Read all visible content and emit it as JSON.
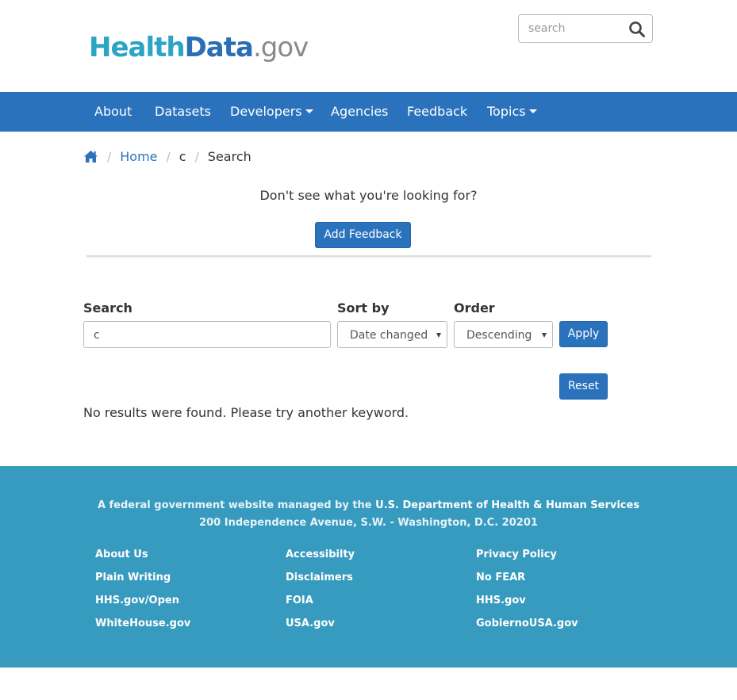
{
  "header": {
    "logo": {
      "part1": "Health",
      "part2": "Data",
      "part3": ".gov"
    },
    "search": {
      "placeholder": "search",
      "icon": "search-icon"
    }
  },
  "nav": {
    "items": [
      {
        "label": "About",
        "dropdown": false
      },
      {
        "label": "Datasets",
        "dropdown": false
      },
      {
        "label": "Developers",
        "dropdown": true
      },
      {
        "label": "Agencies",
        "dropdown": false
      },
      {
        "label": "Feedback",
        "dropdown": false
      },
      {
        "label": "Topics",
        "dropdown": true
      }
    ]
  },
  "breadcrumb": {
    "home_icon": "home-icon",
    "items": [
      "Home",
      "c",
      "Search"
    ]
  },
  "feedback": {
    "prompt": "Don't see what you're looking for?",
    "button_label": "Add Feedback"
  },
  "search_form": {
    "search_label": "Search",
    "search_value": "c",
    "sort_label": "Sort by",
    "sort_value": "Date changed",
    "order_label": "Order",
    "order_value": "Descending",
    "apply_label": "Apply",
    "reset_label": "Reset"
  },
  "results": {
    "message": "No results were found. Please try another keyword."
  },
  "footer": {
    "line1_prefix": "A federal government website managed by the ",
    "line1_link": "U.S. Department of Health & Human Services",
    "line2": "200 Independence Avenue, S.W. - Washington, D.C. 20201",
    "columns": [
      [
        "About Us",
        "Plain Writing",
        "HHS.gov/Open",
        "WhiteHouse.gov"
      ],
      [
        "Accessibilty",
        "Disclaimers",
        "FOIA",
        "USA.gov"
      ],
      [
        "Privacy Policy",
        "No FEAR",
        "HHS.gov",
        "GobiernoUSA.gov"
      ]
    ]
  },
  "colors": {
    "nav_bg": "#2b72bd",
    "footer_bg": "#379abf",
    "logo_health": "#2ba4c5",
    "logo_data": "#2a6fb4",
    "logo_gov": "#8a8a8a"
  }
}
